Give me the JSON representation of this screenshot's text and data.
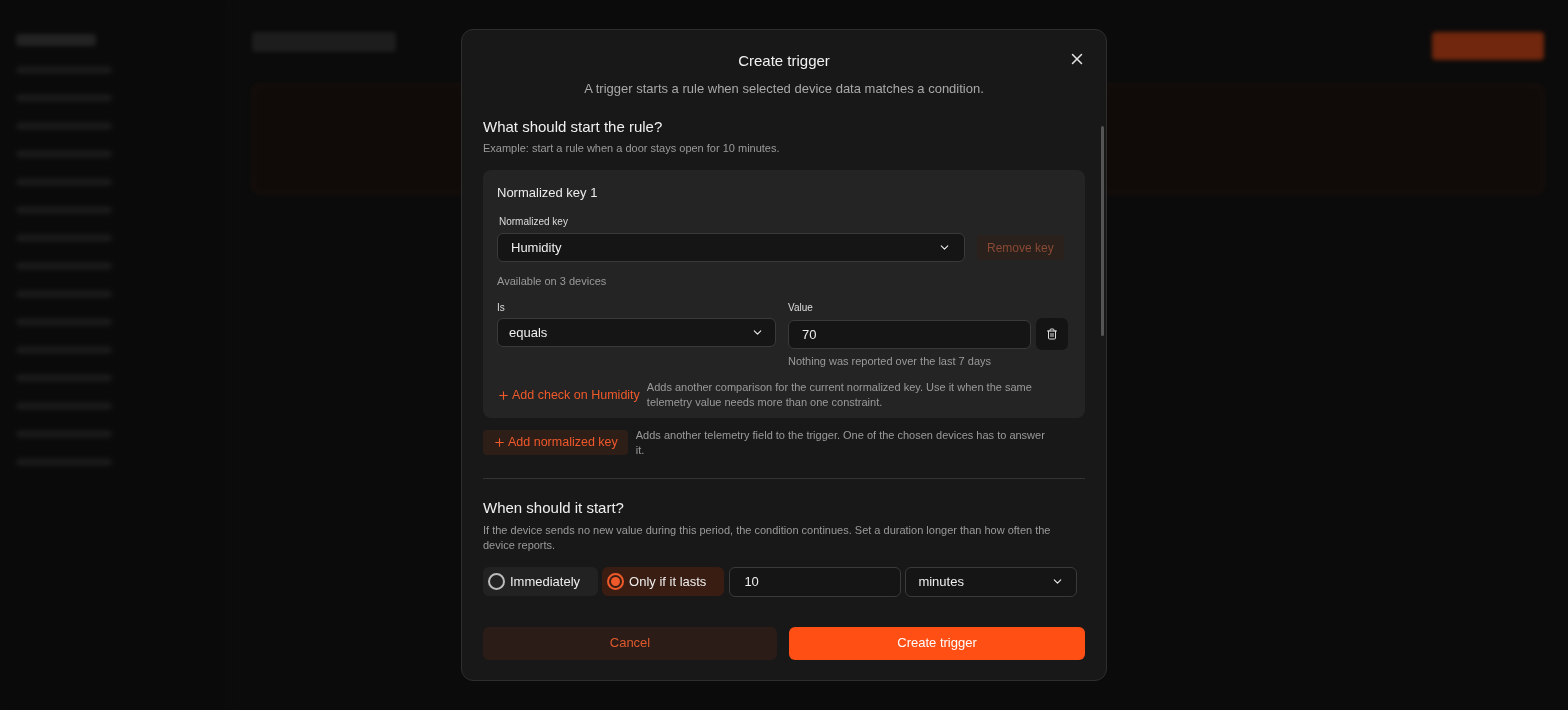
{
  "dialog": {
    "title": "Create trigger",
    "subtitle": "A trigger starts a rule when selected device data matches a condition."
  },
  "condition_section": {
    "heading": "What should start the rule?",
    "hint": "Example: start a rule when a door stays open for 10 minutes."
  },
  "keys": [
    {
      "title": "Normalized key 1",
      "field_label": "Normalized key",
      "value": "Humidity",
      "remove": {
        "label": "Remove key",
        "disabled": true
      },
      "availability": "Available on 3 devices",
      "checks": [
        {
          "op_label": "Is",
          "op": "equals",
          "value_label": "Value",
          "value": "70",
          "note": "Nothing was reported over the last 7 days"
        }
      ],
      "add_check": {
        "label": "Add check on Humidity",
        "help": "Adds another comparison for the current normalized key. Use it when the same telemetry value needs more than one constraint."
      }
    }
  ],
  "add_key": {
    "label": "Add normalized key",
    "help": "Adds another telemetry field to the trigger. One of the chosen devices has to answer it."
  },
  "timing_section": {
    "heading": "When should it start?",
    "hint": "If the device sends no new value during this period, the condition continues. Set a duration longer than how often the device reports."
  },
  "start_options": [
    {
      "label": "Immediately",
      "selected": false
    },
    {
      "label": "Only if it lasts",
      "selected": true
    }
  ],
  "duration": {
    "value": "10",
    "unit": "minutes"
  },
  "actions": {
    "cancel": "Cancel",
    "submit": "Create trigger"
  }
}
